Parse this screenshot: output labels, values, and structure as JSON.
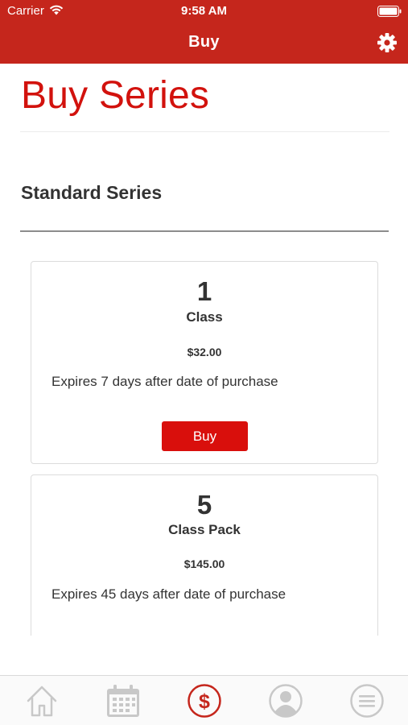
{
  "status_bar": {
    "carrier": "Carrier",
    "time": "9:58 AM",
    "wifi_icon": "wifi-icon",
    "battery_icon": "battery-icon"
  },
  "nav": {
    "title": "Buy",
    "settings_icon": "gear-icon"
  },
  "page": {
    "title": "Buy Series",
    "section_title": "Standard Series"
  },
  "cards": [
    {
      "quantity": "1",
      "name": "Class",
      "price": "$32.00",
      "expiry": "Expires 7 days after date of purchase",
      "button_label": "Buy"
    },
    {
      "quantity": "5",
      "name": "Class Pack",
      "price": "$145.00",
      "expiry": "Expires 45 days after date of purchase"
    }
  ],
  "tab_bar": {
    "items": [
      {
        "icon": "home-icon",
        "active": false
      },
      {
        "icon": "calendar-icon",
        "active": false
      },
      {
        "icon": "dollar-icon",
        "active": true
      },
      {
        "icon": "profile-icon",
        "active": false
      },
      {
        "icon": "menu-icon",
        "active": false
      }
    ]
  },
  "colors": {
    "brand_red": "#c5261c",
    "title_red": "#d2120d",
    "button_red": "#d90f0c",
    "inactive_tab": "#c8c8c8"
  }
}
